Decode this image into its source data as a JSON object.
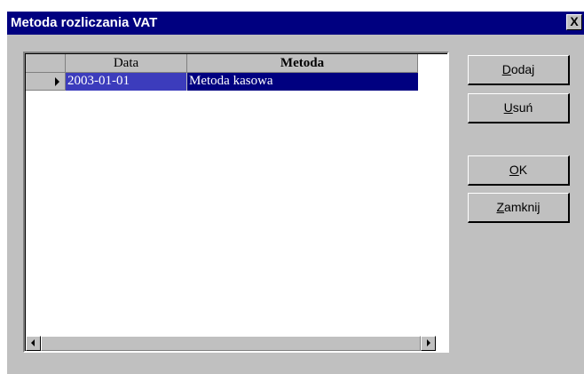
{
  "window": {
    "title": "Metoda rozliczania VAT",
    "close_label": "X"
  },
  "grid": {
    "columns": [
      "Data",
      "Metoda"
    ],
    "rows": [
      {
        "data": "2003-01-01",
        "metoda": "Metoda kasowa",
        "selected": true
      }
    ]
  },
  "buttons": {
    "dodaj": {
      "accel": "D",
      "rest": "odaj"
    },
    "usun": {
      "accel": "U",
      "rest": "suń"
    },
    "ok": {
      "accel": "O",
      "rest": "K"
    },
    "zamknij": {
      "accel": "Z",
      "rest": "amknij"
    }
  },
  "colors": {
    "titlebar": "#000080",
    "selected_row": "#000080",
    "selected_cell": "#3c3cbc",
    "face": "#c0c0c0"
  }
}
